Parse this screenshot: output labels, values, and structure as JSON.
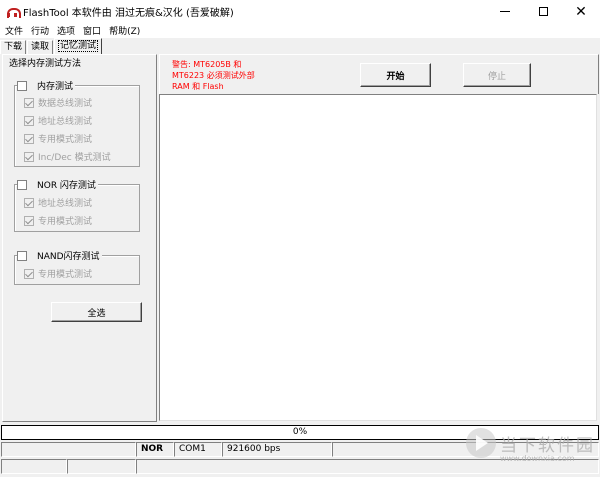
{
  "window": {
    "title": "FlashTool 本软件由 泪过无痕&汉化 (吾爱破解)",
    "controls": {
      "minimize": "",
      "maximize": "",
      "close": "✕"
    }
  },
  "menu": [
    "文件",
    "行动",
    "选项",
    "窗口",
    "帮助(Z)"
  ],
  "tabs": [
    {
      "label": "下载",
      "active": false
    },
    {
      "label": "读取",
      "active": false
    },
    {
      "label": "记忆测试",
      "active": true
    }
  ],
  "left_panel": {
    "title": "选择内存测试方法",
    "groups": [
      {
        "label": "内存测试",
        "checked": false,
        "options": [
          "数据总线测试",
          "地址总线测试",
          "专用模式测试",
          "Inc/Dec 模式测试"
        ]
      },
      {
        "label": "NOR 闪存测试",
        "checked": false,
        "options": [
          "地址总线测试",
          "专用模式测试"
        ]
      },
      {
        "label": "NAND闪存测试",
        "checked": false,
        "options": [
          "专用模式测试"
        ]
      }
    ],
    "select_all_label": "全选"
  },
  "right_panel": {
    "warning_text": "警告: MT6205B 和 MT6223 必须测试外部 RAM 和 Flash",
    "start_label": "开始",
    "stop_label": "停止"
  },
  "progress": {
    "text": "0%",
    "value": 0
  },
  "status": {
    "cells": [
      "",
      "",
      "NOR",
      "COM1",
      "921600 bps",
      "",
      "",
      "",
      ""
    ]
  },
  "watermark": {
    "title": "当下软件园",
    "url": "www.downxia.com"
  },
  "colors": {
    "warning": "#ff0000",
    "progress_fill": "#0000ff",
    "window_bg": "#f0f0f0"
  }
}
